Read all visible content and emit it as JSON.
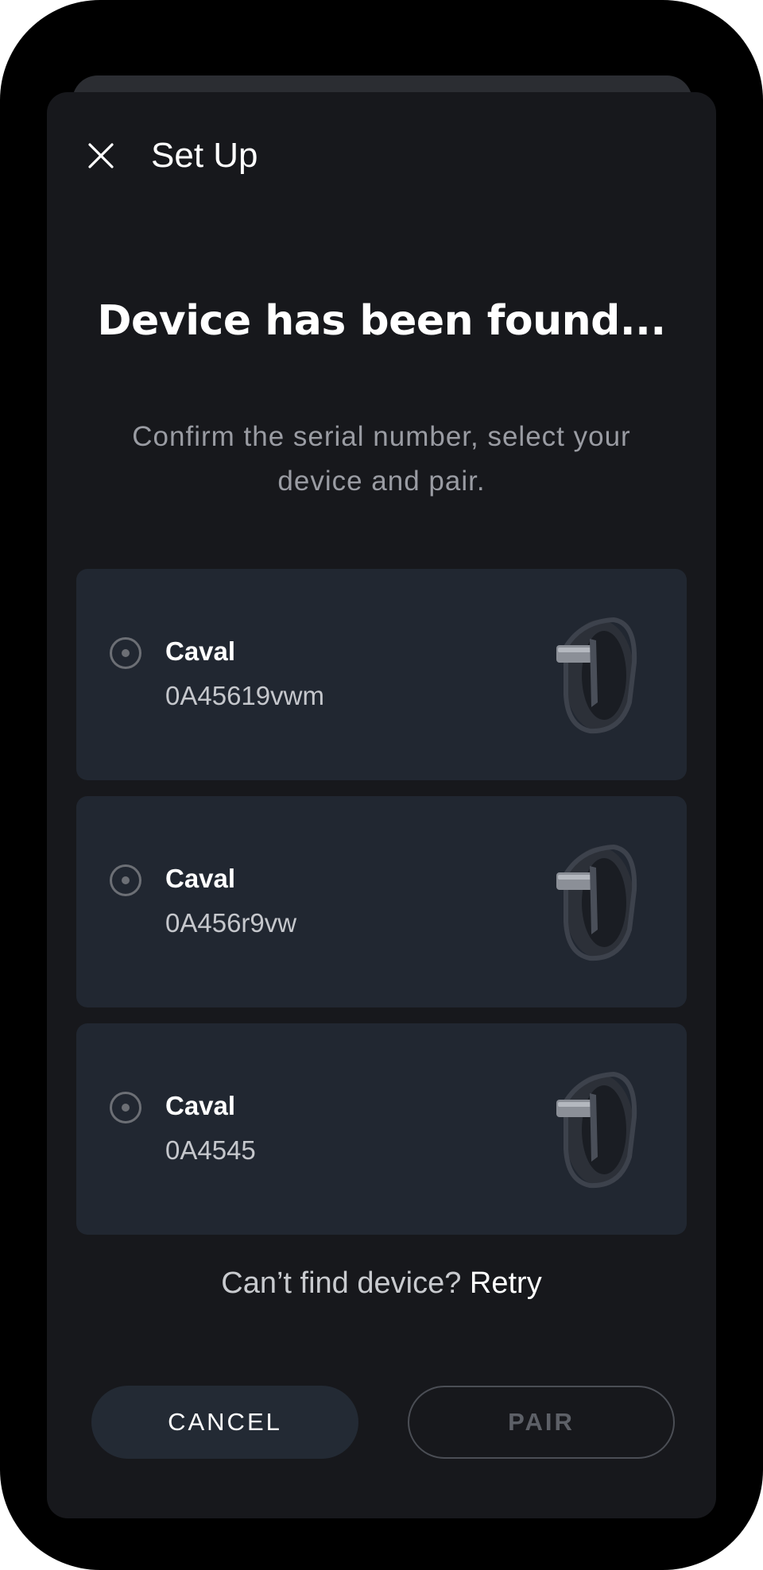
{
  "header": {
    "title": "Set Up",
    "close_icon": "close-icon"
  },
  "main": {
    "headline": "Device has been found...",
    "subtitle": "Confirm the serial number, select your device and pair."
  },
  "devices": [
    {
      "name": "Caval",
      "serial": "0A45619vwm",
      "selected": false,
      "image": "wristband-image"
    },
    {
      "name": "Caval",
      "serial": "0A456r9vw",
      "selected": false,
      "image": "wristband-image"
    },
    {
      "name": "Caval",
      "serial": "0A4545",
      "selected": false,
      "image": "wristband-image"
    }
  ],
  "retry": {
    "prompt": "Can’t find device?",
    "link": "Retry"
  },
  "actions": {
    "cancel_label": "CANCEL",
    "pair_label": "PAIR",
    "pair_enabled": false
  },
  "colors": {
    "background": "#17181c",
    "card": "#212731",
    "text_primary": "#ffffff",
    "text_secondary": "#9a9ca3"
  }
}
